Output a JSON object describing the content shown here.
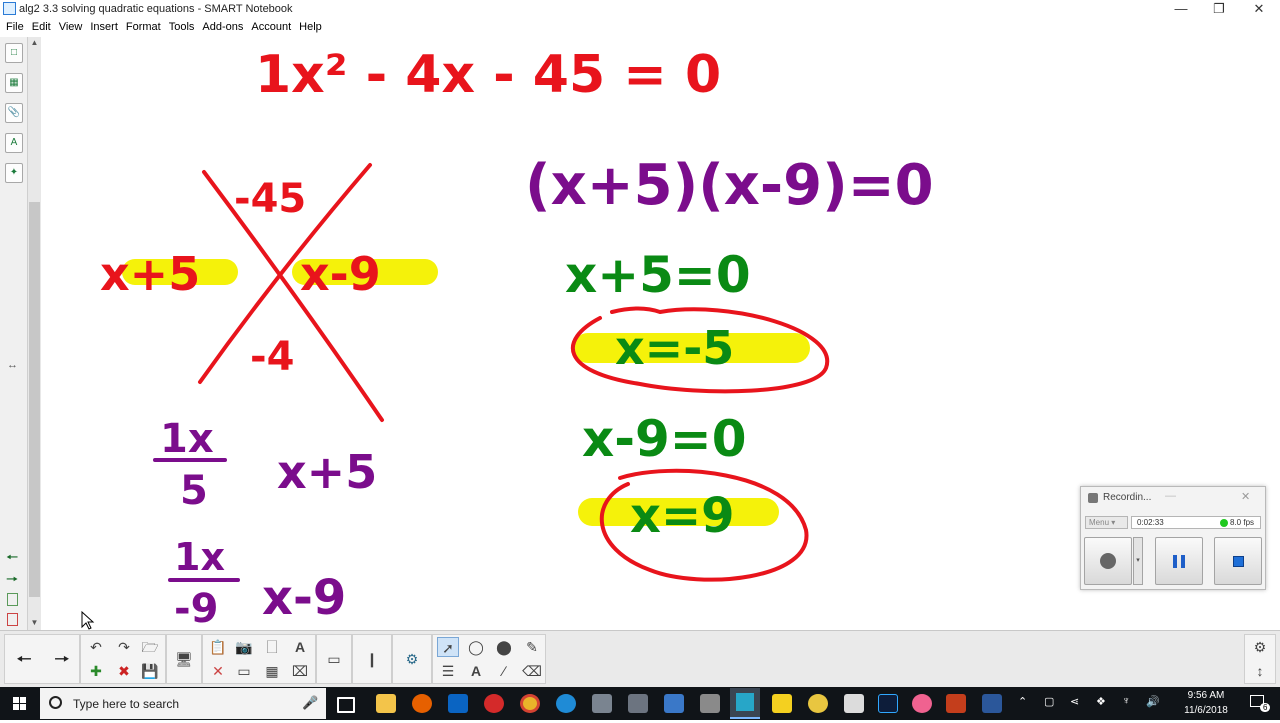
{
  "window": {
    "title": "alg2 3.3 solving quadratic equations - SMART Notebook"
  },
  "menu": [
    "File",
    "Edit",
    "View",
    "Insert",
    "Format",
    "Tools",
    "Add-ons",
    "Account",
    "Help"
  ],
  "whiteboard": {
    "equation": "1x² - 4x - 45 = 0",
    "x_diagram": {
      "top": "-45",
      "bottom": "-4",
      "left": "x+5",
      "right": "x-9"
    },
    "fraction1": {
      "numerator": "1x",
      "denominator": "5",
      "result": "x+5"
    },
    "fraction2": {
      "numerator": "1x",
      "denominator": "-9",
      "result": "x-9"
    },
    "factored": "(x+5)(x-9)=0",
    "step1": "x+5=0",
    "solution1": "x=-5",
    "step2": "x-9=0",
    "solution2": "x=9",
    "colors": {
      "red": "#e8141c",
      "purple": "#7b0d8c",
      "green": "#0a8a14",
      "yellow": "#f5f20a"
    }
  },
  "recorder": {
    "title": "Recordin...",
    "menu_label": "Menu",
    "elapsed": "0:02:33",
    "fps": "8.0 fps",
    "buttons": [
      "record",
      "pause",
      "stop"
    ]
  },
  "taskbar": {
    "search_placeholder": "Type here to search",
    "time": "9:56 AM",
    "date": "11/6/2018",
    "notification_count": "6"
  }
}
